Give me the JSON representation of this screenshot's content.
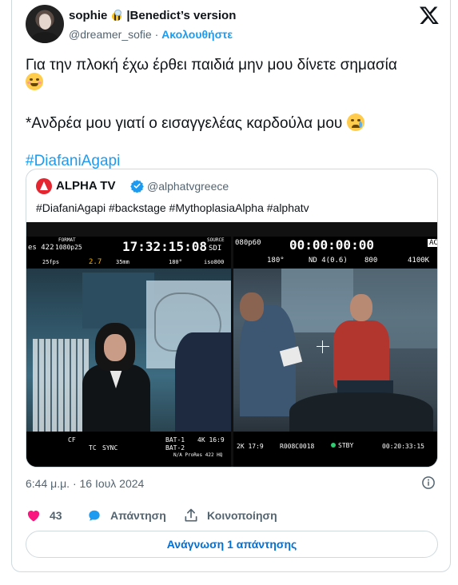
{
  "author": {
    "display_name": "sophie",
    "name_suffix": "|Benedict’s version",
    "name_emoji_icon": "bee-icon",
    "handle": "@dreamer_sofie",
    "separator": "·",
    "follow_label": "Ακολουθήστε"
  },
  "platform_icon": "x-logo-icon",
  "tweet": {
    "line1": "Για την πλοκή έχω έρθει παιδιά μην μου δίνετε σημασία",
    "line1_emoji_icon": "blushing-face-emoji-icon",
    "line2": "*Ανδρέα μου γιατί ο εισαγγελέας καρδούλα μου",
    "line2_emoji_icon": "face-holding-back-tears-emoji-icon",
    "hashtag": "#DiafaniAgapi"
  },
  "quoted": {
    "name": "ALPHA TV",
    "verified_icon": "verified-badge-icon",
    "handle": "@alphatvgreece",
    "tags": "#DiafaniAgapi #backstage #MythoplasiaAlpha #alphatv",
    "image_left": {
      "timecode": "17:32:15:08",
      "format_label": "FORMAT",
      "format_value": "1080p25",
      "source_label": "SOURCE",
      "source_value": "SDI",
      "codec": "es 422",
      "fps": "25fps",
      "aperture": "2.7",
      "lens": "35mm",
      "shutter": "180°",
      "iso": "iso800",
      "bottom_cf": "CF",
      "bottom_tc": "TC",
      "bottom_sync": "SYNC",
      "bottom_bat": "BAT-1",
      "bottom_bat2": "BAT-2",
      "bottom_rec": "4K 16:9",
      "bottom_prores": "N/A  ProRes 422 HQ"
    },
    "image_right": {
      "format": "080p60",
      "timecode": "00:00:00:00",
      "ac_label": "AC",
      "shutter": "180°",
      "nd": "ND 4(0.6)",
      "iso": "800",
      "wb": "4100K",
      "lens_info": "2K 17:9",
      "clip": "R008C0018",
      "status": "STBY",
      "tc_bottom": "00:20:33:15"
    }
  },
  "footer": {
    "timestamp": "6:44 μ.μ. · 16 Ιουλ 2024",
    "info_icon": "info-icon",
    "like_count": "43",
    "reply_label": "Απάντηση",
    "share_label": "Κοινοποίηση",
    "read_replies_label": "Ανάγνωση 1 απάντησης"
  },
  "colors": {
    "link_blue": "#1d9bf0",
    "like_pink": "#f91880",
    "text_secondary": "#536471",
    "border": "#cfd9de",
    "alpha_red": "#e3262f"
  }
}
